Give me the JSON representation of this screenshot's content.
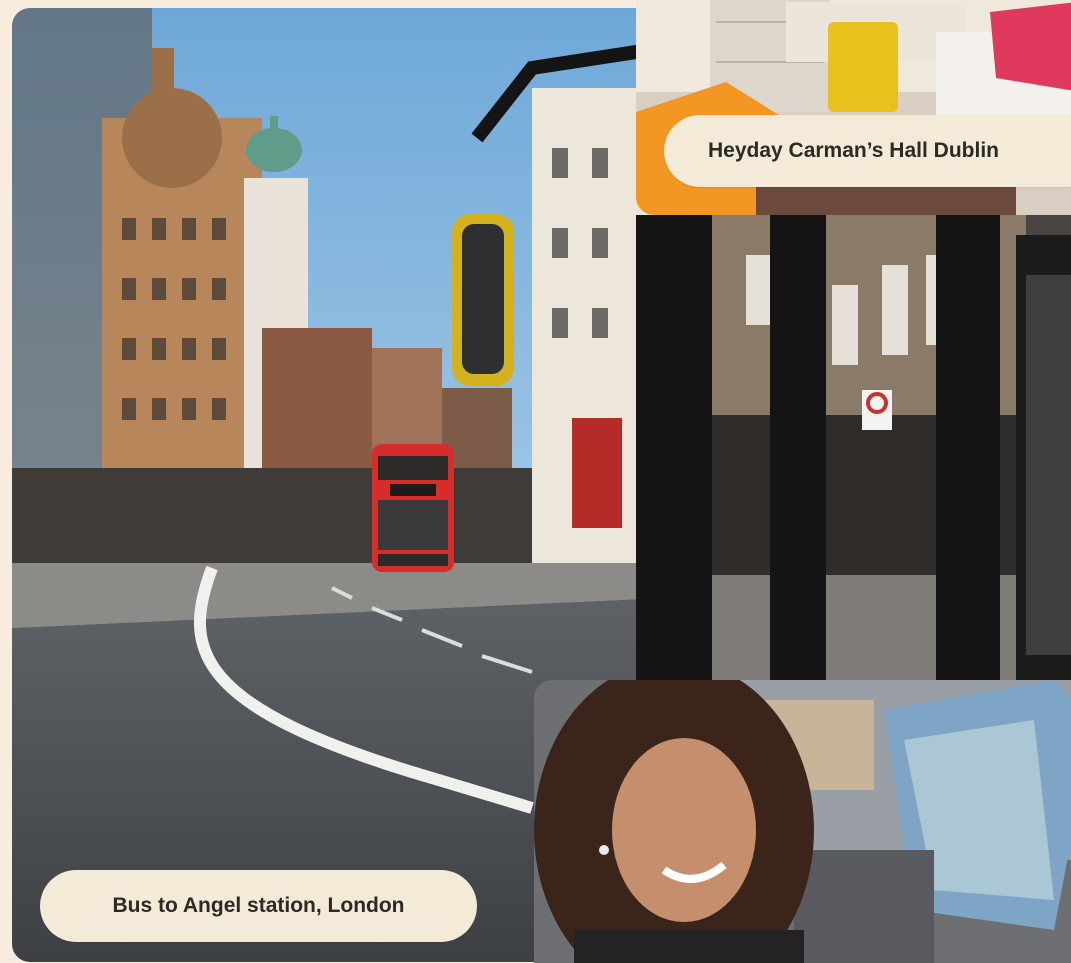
{
  "tiles": {
    "london": {
      "image_description": "street-photo",
      "caption": "Bus to Angel station, London",
      "bus_destination": "Angel"
    },
    "dublin": {
      "image_description": "dorm-room-photo",
      "caption": "Heyday Carman’s Hall Dublin"
    },
    "bus_window": {
      "image_description": "bus-window-street-photo"
    },
    "woman": {
      "image_description": "smiling-woman-photo"
    }
  },
  "colors": {
    "background": "#f7ecde",
    "caption_bg": "#f3ead8",
    "caption_text": "#2b2a26",
    "bus_red": "#d62d2a",
    "sky": "#a8cde8"
  }
}
